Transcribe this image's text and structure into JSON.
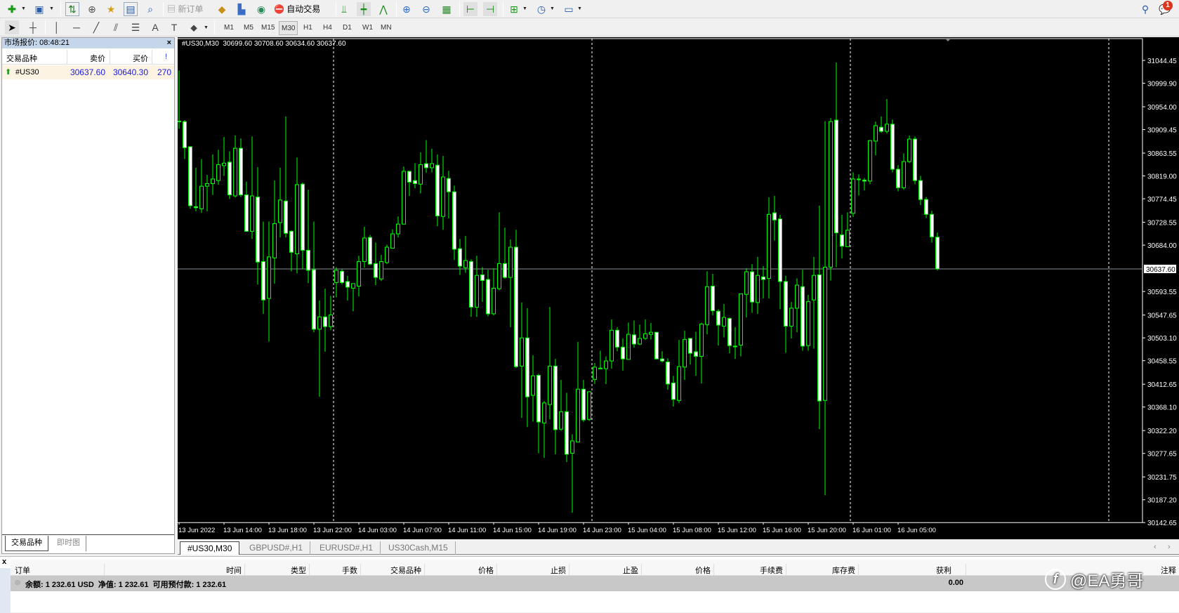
{
  "toolbar": {
    "new_order": "新订单",
    "auto_trading": "自动交易",
    "notification_count": "1",
    "timeframes": [
      "M1",
      "M5",
      "M15",
      "M30",
      "H1",
      "H4",
      "D1",
      "W1",
      "MN"
    ],
    "active_timeframe": "M30"
  },
  "market_watch": {
    "title": "市场报价: 08:48:21",
    "close": "×",
    "columns": {
      "symbol": "交易品种",
      "bid": "卖价",
      "ask": "买价",
      "spread": "!"
    },
    "rows": [
      {
        "symbol": "#US30",
        "bid": "30637.60",
        "ask": "30640.30",
        "spread": "270"
      }
    ],
    "tabs": [
      "交易品种",
      "即时图"
    ]
  },
  "chart": {
    "header": "#US30,M30  30699.60 30708.60 30634.60 30637.60",
    "current_price_label": "30637.60",
    "tabs": [
      "#US30,M30",
      "GBPUSD#,H1",
      "EURUSD#,H1",
      "US30Cash,M15"
    ],
    "bull_color": "#00ff00",
    "bear_fill": "#ffffff"
  },
  "chart_data": {
    "type": "candlestick",
    "symbol": "#US30",
    "timeframe": "M30",
    "ylim": [
      30142.65,
      31044.45
    ],
    "current_price": 30637.6,
    "price_ticks": [
      "31044.45",
      "30999.90",
      "30954.00",
      "30909.45",
      "30863.55",
      "30819.00",
      "30774.45",
      "30728.55",
      "30684.00",
      "30593.55",
      "30547.65",
      "30503.10",
      "30458.55",
      "30412.65",
      "30368.10",
      "30322.20",
      "30277.65",
      "30231.75",
      "30187.20",
      "30142.65"
    ],
    "price_tick_values": [
      31044.45,
      30999.9,
      30954.0,
      30909.45,
      30863.55,
      30819.0,
      30774.45,
      30728.55,
      30684.0,
      30593.55,
      30547.65,
      30503.1,
      30458.55,
      30412.65,
      30368.1,
      30322.2,
      30277.65,
      30231.75,
      30187.2,
      30142.65
    ],
    "time_labels": [
      "13 Jun 2022",
      "13 Jun 14:00",
      "13 Jun 18:00",
      "13 Jun 22:00",
      "14 Jun 03:00",
      "14 Jun 07:00",
      "14 Jun 11:00",
      "14 Jun 15:00",
      "14 Jun 19:00",
      "14 Jun 23:00",
      "15 Jun 04:00",
      "15 Jun 08:00",
      "15 Jun 12:00",
      "15 Jun 16:00",
      "15 Jun 20:00",
      "16 Jun 01:00",
      "16 Jun 05:00"
    ],
    "time_label_bar_step": 8,
    "day_separator_bars": [
      28,
      74,
      120,
      166
    ],
    "ohlc_fields": [
      "open",
      "high",
      "low",
      "close"
    ],
    "candles": [
      [
        30926,
        31025,
        30911,
        30925
      ],
      [
        30925,
        30928,
        30852,
        30874
      ],
      [
        30876,
        30877,
        30755,
        30761
      ],
      [
        30759,
        30835,
        30750,
        30757
      ],
      [
        30755,
        30852,
        30747,
        30799
      ],
      [
        30799,
        30821,
        30750,
        30804
      ],
      [
        30804,
        30861,
        30782,
        30813
      ],
      [
        30810,
        30870,
        30802,
        30841
      ],
      [
        30839,
        30895,
        30819,
        30844
      ],
      [
        30846,
        30867,
        30774,
        30782
      ],
      [
        30780,
        30898,
        30777,
        30873
      ],
      [
        30873,
        30892,
        30778,
        30782
      ],
      [
        30782,
        30808,
        30710,
        30711
      ],
      [
        30711,
        30896,
        30696,
        30780
      ],
      [
        30778,
        30836,
        30607,
        30651
      ],
      [
        30652,
        30730,
        30550,
        30577
      ],
      [
        30580,
        30730,
        30496,
        30661
      ],
      [
        30659,
        30810,
        30609,
        30726
      ],
      [
        30728,
        30835,
        30699,
        30772
      ],
      [
        30770,
        30935,
        30699,
        30707
      ],
      [
        30711,
        30713,
        30633,
        30670
      ],
      [
        30667,
        30855,
        30629,
        30802
      ],
      [
        30803,
        30806,
        30637,
        30674
      ],
      [
        30674,
        30792,
        30610,
        30635
      ],
      [
        30636,
        30730,
        30514,
        30520
      ],
      [
        30520,
        30576,
        30388,
        30544
      ],
      [
        30544,
        30599,
        30476,
        30525
      ],
      [
        30525,
        30585,
        30518,
        30548
      ],
      [
        30611,
        30641,
        30582,
        30635
      ],
      [
        30633,
        30637,
        30607,
        30611
      ],
      [
        30613,
        30624,
        30576,
        30602
      ],
      [
        30600,
        30609,
        30555,
        30609
      ],
      [
        30604,
        30663,
        30584,
        30652
      ],
      [
        30652,
        30720,
        30640,
        30698
      ],
      [
        30699,
        30704,
        30645,
        30647
      ],
      [
        30648,
        30689,
        30606,
        30621
      ],
      [
        30618,
        30665,
        30614,
        30652
      ],
      [
        30650,
        30685,
        30647,
        30680
      ],
      [
        30678,
        30715,
        30678,
        30706
      ],
      [
        30706,
        30740,
        30699,
        30725
      ],
      [
        30725,
        30837,
        30724,
        30828
      ],
      [
        30828,
        30828,
        30780,
        30807
      ],
      [
        30810,
        30844,
        30795,
        30804
      ],
      [
        30803,
        30865,
        30785,
        30841
      ],
      [
        30843,
        30889,
        30825,
        30835
      ],
      [
        30835,
        30872,
        30826,
        30843
      ],
      [
        30840,
        30861,
        30721,
        30741
      ],
      [
        30740,
        30858,
        30714,
        30817
      ],
      [
        30814,
        30829,
        30736,
        30788
      ],
      [
        30788,
        30800,
        30655,
        30676
      ],
      [
        30677,
        30696,
        30626,
        30643
      ],
      [
        30640,
        30702,
        30630,
        30654
      ],
      [
        30652,
        30656,
        30544,
        30563
      ],
      [
        30563,
        30663,
        30544,
        30625
      ],
      [
        30626,
        30641,
        30573,
        30615
      ],
      [
        30617,
        30636,
        30545,
        30550
      ],
      [
        30550,
        30639,
        30547,
        30600
      ],
      [
        30599,
        30748,
        30596,
        30648
      ],
      [
        30648,
        30718,
        30618,
        30621
      ],
      [
        30621,
        30695,
        30524,
        30680
      ],
      [
        30680,
        30714,
        30444,
        30447
      ],
      [
        30448,
        30572,
        30347,
        30503
      ],
      [
        30503,
        30561,
        30329,
        30388
      ],
      [
        30391,
        30469,
        30340,
        30429
      ],
      [
        30430,
        30433,
        30278,
        30339
      ],
      [
        30337,
        30380,
        30269,
        30376
      ],
      [
        30373,
        30563,
        30344,
        30448
      ],
      [
        30448,
        30462,
        30276,
        30324
      ],
      [
        30325,
        30421,
        30322,
        30359
      ],
      [
        30359,
        30396,
        30261,
        30276
      ],
      [
        30278,
        30315,
        30162,
        30302
      ],
      [
        30300,
        30495,
        30299,
        30403
      ],
      [
        30403,
        30421,
        30339,
        30343
      ],
      [
        30344,
        30399,
        30341,
        30398
      ],
      [
        30422,
        30454,
        30413,
        30446
      ],
      [
        30443,
        30478,
        30443,
        30444
      ],
      [
        30443,
        30467,
        30413,
        30458
      ],
      [
        30458,
        30539,
        30443,
        30518
      ],
      [
        30518,
        30524,
        30477,
        30485
      ],
      [
        30485,
        30502,
        30439,
        30462
      ],
      [
        30461,
        30533,
        30461,
        30510
      ],
      [
        30509,
        30537,
        30484,
        30491
      ],
      [
        30491,
        30529,
        30489,
        30502
      ],
      [
        30502,
        30539,
        30499,
        30511
      ],
      [
        30510,
        30532,
        30500,
        30514
      ],
      [
        30514,
        30514,
        30461,
        30462
      ],
      [
        30462,
        30477,
        30455,
        30458
      ],
      [
        30456,
        30463,
        30402,
        30413
      ],
      [
        30415,
        30429,
        30369,
        30383
      ],
      [
        30381,
        30499,
        30376,
        30447
      ],
      [
        30446,
        30517,
        30421,
        30500
      ],
      [
        30502,
        30502,
        30451,
        30473
      ],
      [
        30476,
        30515,
        30429,
        30467
      ],
      [
        30467,
        30533,
        30414,
        30530
      ],
      [
        30529,
        30633,
        30510,
        30603
      ],
      [
        30604,
        30628,
        30547,
        30556
      ],
      [
        30555,
        30559,
        30488,
        30528
      ],
      [
        30526,
        30569,
        30504,
        30543
      ],
      [
        30541,
        30543,
        30473,
        30488
      ],
      [
        30487,
        30524,
        30462,
        30486
      ],
      [
        30489,
        30589,
        30467,
        30589
      ],
      [
        30588,
        30639,
        30543,
        30632
      ],
      [
        30632,
        30647,
        30552,
        30573
      ],
      [
        30572,
        30661,
        30550,
        30625
      ],
      [
        30622,
        30643,
        30580,
        30617
      ],
      [
        30619,
        30777,
        30580,
        30744
      ],
      [
        30747,
        30780,
        30693,
        30733
      ],
      [
        30735,
        30743,
        30559,
        30613
      ],
      [
        30613,
        30624,
        30474,
        30526
      ],
      [
        30526,
        30573,
        30502,
        30561
      ],
      [
        30561,
        30619,
        30514,
        30606
      ],
      [
        30603,
        30636,
        30478,
        30487
      ],
      [
        30488,
        30587,
        30478,
        30574
      ],
      [
        30577,
        30661,
        30482,
        30625
      ],
      [
        30626,
        30761,
        30325,
        30380
      ],
      [
        30381,
        30926,
        30196,
        30641
      ],
      [
        30641,
        30932,
        30615,
        30925
      ],
      [
        30928,
        31040,
        30641,
        30708
      ],
      [
        30704,
        30743,
        30658,
        30682
      ],
      [
        30681,
        30748,
        30680,
        30713
      ],
      [
        30746,
        30826,
        30739,
        30813
      ],
      [
        30813,
        30822,
        30781,
        30812
      ],
      [
        30811,
        30815,
        30791,
        30809
      ],
      [
        30809,
        30889,
        30803,
        30888
      ],
      [
        30887,
        30925,
        30859,
        30917
      ],
      [
        30914,
        30935,
        30903,
        30906
      ],
      [
        30906,
        30969,
        30902,
        30920
      ],
      [
        30920,
        30929,
        30826,
        30832
      ],
      [
        30832,
        30840,
        30789,
        30796
      ],
      [
        30796,
        30863,
        30792,
        30847
      ],
      [
        30847,
        30898,
        30844,
        30891
      ],
      [
        30891,
        30896,
        30803,
        30810
      ],
      [
        30810,
        30819,
        30762,
        30773
      ],
      [
        30773,
        30778,
        30737,
        30744
      ],
      [
        30744,
        30751,
        30689,
        30700
      ],
      [
        30699.6,
        30708.6,
        30634.6,
        30637.6
      ]
    ]
  },
  "terminal": {
    "close": "x",
    "columns": [
      "订单",
      "时间",
      "类型",
      "手数",
      "交易品种",
      "价格",
      "止损",
      "止盈",
      "价格",
      "手续费",
      "库存费",
      "获利",
      "注释"
    ],
    "balance_text": "余额: 1 232.61 USD  净值: 1 232.61  可用预付款: 1 232.61",
    "profit": "0.00"
  },
  "watermark": "@EA勇哥"
}
